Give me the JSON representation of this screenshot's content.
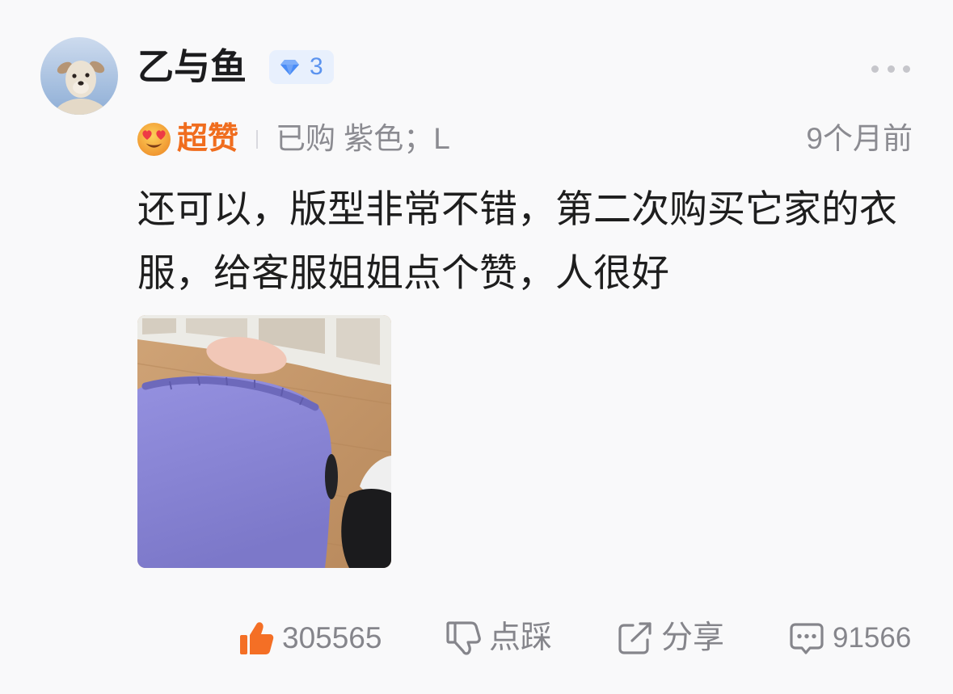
{
  "user": {
    "name": "乙与鱼",
    "level": "3",
    "level_icon": "diamond-icon"
  },
  "menu": {
    "icon": "more-icon"
  },
  "review": {
    "rating_icon": "heart-eyes-emoji-icon",
    "rating_label": "超赞",
    "purchase_info": "已购 紫色；L",
    "time_ago": "9个月前",
    "text": "还可以，版型非常不错，第二次购买它家的衣服，给客服姐姐点个赞，人很好"
  },
  "actions": {
    "like": {
      "icon": "thumbs-up-icon",
      "count": "305565"
    },
    "dislike": {
      "icon": "thumbs-down-icon",
      "label": "点踩"
    },
    "share": {
      "icon": "share-icon",
      "label": "分享"
    },
    "comment": {
      "icon": "comment-icon",
      "count": "91566"
    }
  },
  "colors": {
    "background": "#f9f9fa",
    "rating_accent": "#f06d1e",
    "like_active": "#f46f25",
    "badge_background": "#e8f0fd",
    "badge_accent": "#4a8cf6",
    "secondary_text": "#8b8b91"
  }
}
